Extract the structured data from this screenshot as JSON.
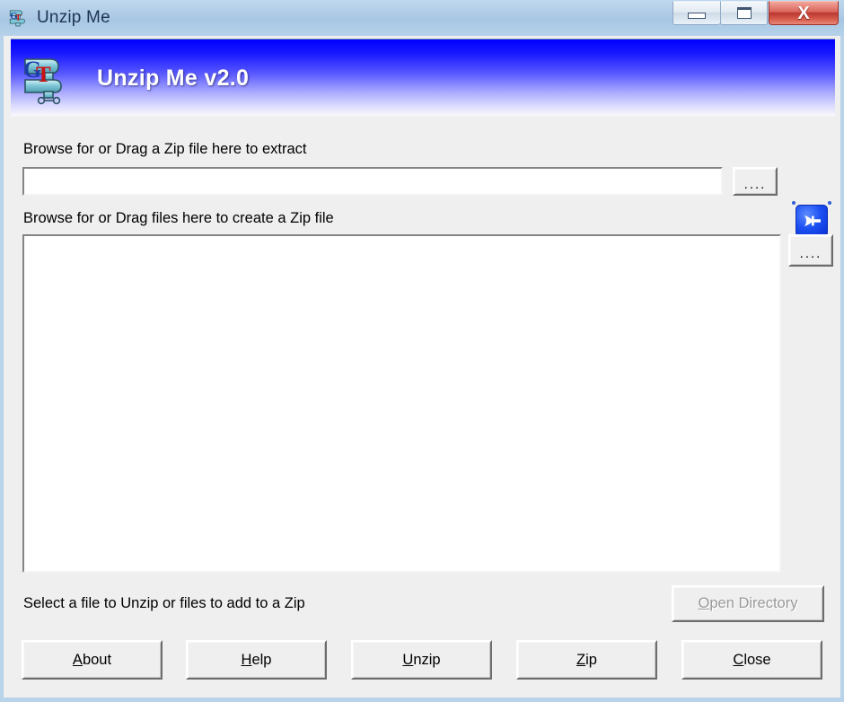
{
  "window": {
    "title": "Unzip Me",
    "icon": "app-logo-icon",
    "caption_buttons": [
      {
        "name": "minimize",
        "label": "–"
      },
      {
        "name": "maximize",
        "label": "□"
      },
      {
        "name": "close",
        "label": "X"
      }
    ]
  },
  "banner": {
    "title": "Unzip Me v2.0",
    "logo": "clamp-gt-logo-icon",
    "gradient_top": "#0000ff",
    "gradient_bottom": "#ffffff"
  },
  "form": {
    "zip_extract_label": "Browse for or Drag a Zip file here to extract",
    "zip_input_value": "",
    "zip_input_placeholder": "",
    "browse_zip_label": "....",
    "zip_create_label": "Browse for or Drag files here to create a Zip file",
    "browse_files_label": "....",
    "file_list_items": [],
    "pin_button": {
      "name": "always-on-top-toggle",
      "icon": "pushpin-icon",
      "color": "#1b4ff2",
      "pressed": true
    }
  },
  "status": {
    "text": "Select a file to Unzip or files to add to a Zip"
  },
  "buttons": {
    "open_directory": {
      "accel": "O",
      "rest": "pen Directory",
      "enabled": false
    },
    "about": {
      "accel": "A",
      "rest": "bout"
    },
    "help": {
      "accel": "H",
      "rest": "elp"
    },
    "unzip": {
      "accel": "U",
      "rest": "nzip"
    },
    "zip": {
      "accel": "Z",
      "rest": "ip"
    },
    "close": {
      "accel": "C",
      "rest": "lose"
    }
  },
  "colors": {
    "titlebar": "#aecde8",
    "client_bg": "#efefef",
    "accent_blue": "#0000ff",
    "close_red": "#b8362f"
  }
}
